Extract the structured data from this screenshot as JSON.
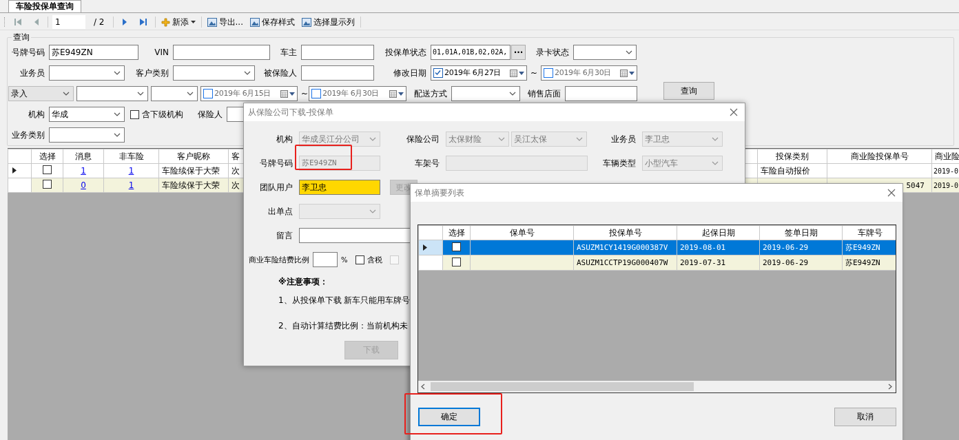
{
  "tab": {
    "label": "车险投保单查询",
    "selected": true
  },
  "toolbar": {
    "page": "1",
    "page_total": "/ 2",
    "add": "新添",
    "buttons": [
      "导出...",
      "保存样式",
      "选择显示列"
    ]
  },
  "query": {
    "title": "查询",
    "rows": [
      [
        {
          "kind": "label",
          "text": "号牌号码"
        },
        {
          "kind": "text",
          "value": "苏E949ZN"
        },
        {
          "kind": "label",
          "text": "VIN"
        },
        {
          "kind": "text"
        },
        {
          "kind": "label",
          "text": "车主"
        },
        {
          "kind": "text"
        },
        {
          "kind": "label",
          "text": "投保单状态"
        },
        {
          "kind": "text",
          "value": "01,01A,01B,02,02A,"
        },
        {
          "kind": "ellipsis",
          "text": "···"
        },
        {
          "kind": "label",
          "text": "录卡状态"
        },
        {
          "kind": "combo"
        }
      ],
      [
        {
          "kind": "label",
          "text": "业务员"
        },
        {
          "kind": "combo"
        },
        {
          "kind": "label",
          "text": "客户类别"
        },
        {
          "kind": "combo"
        },
        {
          "kind": "label",
          "text": "被保险人"
        },
        {
          "kind": "text"
        },
        {
          "kind": "label",
          "text": "修改日期"
        },
        {
          "kind": "date",
          "checked": true,
          "value": "2019年 6月27日"
        },
        {
          "kind": "tilde",
          "text": "~"
        },
        {
          "kind": "date",
          "checked": false,
          "value": "2019年 6月30日"
        }
      ],
      [
        {
          "kind": "flatcombo",
          "value": "录入"
        },
        {
          "kind": "combo"
        },
        {
          "kind": "combo"
        },
        {
          "kind": "date",
          "checked": false,
          "value": "2019年 6月15日"
        },
        {
          "kind": "tilde",
          "text": "~"
        },
        {
          "kind": "date",
          "checked": false,
          "value": "2019年 6月30日"
        },
        {
          "kind": "label",
          "text": "配送方式"
        },
        {
          "kind": "combo"
        },
        {
          "kind": "label",
          "text": "销售店面"
        },
        {
          "kind": "text"
        },
        {
          "kind": "button",
          "text": "查询"
        }
      ],
      [
        {
          "kind": "label",
          "text": "机构"
        },
        {
          "kind": "combo",
          "value": "华成"
        },
        {
          "kind": "check",
          "text": "含下级机构",
          "checked": false
        },
        {
          "kind": "label",
          "text": "保险人"
        },
        {
          "kind": "text"
        }
      ],
      [
        {
          "kind": "label",
          "text": "业务类别"
        },
        {
          "kind": "combo"
        }
      ]
    ]
  },
  "grid": {
    "columns": [
      "选择",
      "消息",
      "非车险",
      "客户昵称",
      "客",
      "投保类别",
      "商业险投保单号",
      "商业险"
    ],
    "rows": [
      {
        "selected": true,
        "checked": false,
        "message": "1",
        "non_auto": "1",
        "nickname": "车险续保于大荣",
        "column_5": "次",
        "category": "车险自动报价",
        "commercial_date": "2019-0"
      },
      {
        "selected": false,
        "checked": false,
        "message": "0",
        "non_auto": "1",
        "nickname": "车险续保于大荣",
        "column_5": "次",
        "commercial_no": "5047",
        "commercial_date": "2019-0"
      }
    ]
  },
  "download_dialog": {
    "title": "从保险公司下载-投保单",
    "org_label": "机构",
    "org": {
      "value": "华成吴江分公司",
      "disabled": true
    },
    "insurer_label": "保险公司",
    "insurer": {
      "value": "太保财险",
      "disabled": true
    },
    "branch": {
      "value": "吴江太保",
      "disabled": true
    },
    "salesman_label": "业务员",
    "salesman": {
      "value": "李卫忠",
      "disabled": true
    },
    "plate_label": "号牌号码",
    "plate": {
      "value": "苏E949ZN",
      "disabled": true
    },
    "vin_label": "车架号",
    "vehicle_type_label": "车辆类型",
    "vehicle_type": {
      "value": "小型汽车",
      "disabled": true
    },
    "team_label": "团队用户",
    "team": "李卫忠",
    "change_button": {
      "label": "更改",
      "disabled": true
    },
    "outlet_label": "出单点",
    "note_label": "留言",
    "ratio_label": "商业车险结费比例",
    "ratio_unit": "%",
    "tax": {
      "label": "含税",
      "checked": false
    },
    "extra_checkbox": {
      "checked": false,
      "disabled": true
    },
    "notice_title": "※注意事项：",
    "notices": [
      "1、从投保单下载 新车只能用车牌号",
      "2、自动计算结费比例：当前机构未"
    ],
    "download_button": {
      "label": "下载",
      "disabled": true
    }
  },
  "summary_dialog": {
    "title": "保单摘要列表",
    "columns": [
      "选择",
      "保单号",
      "投保单号",
      "起保日期",
      "签单日期",
      "车牌号"
    ],
    "rows": [
      {
        "selected": true,
        "checked": false,
        "application_no": "ASUZM1CY1419G000387V",
        "start_date": "2019-08-01",
        "sign_date": "2019-06-29",
        "plate": "苏E949ZN"
      },
      {
        "selected": false,
        "checked": false,
        "application_no": "ASUZM1CCTP19G000407W",
        "start_date": "2019-07-31",
        "sign_date": "2019-06-29",
        "plate": "苏E949ZN"
      }
    ],
    "ok": "确定",
    "cancel": "取消"
  },
  "annotations": [
    {
      "kind": "rect"
    },
    {
      "kind": "rect"
    }
  ]
}
